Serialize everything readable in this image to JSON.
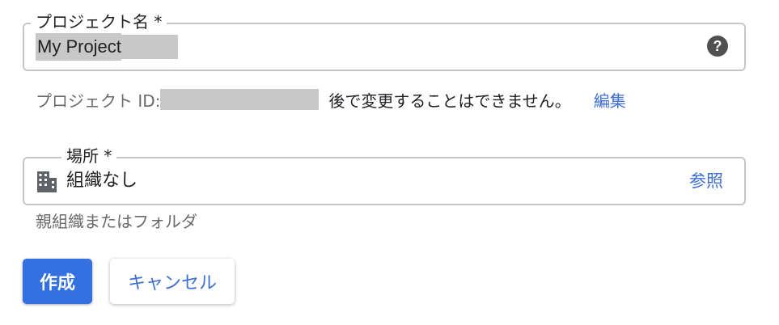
{
  "project_name": {
    "label": "プロジェクト名 *",
    "value": "My Project",
    "help_icon": "help-circle-icon"
  },
  "project_id": {
    "label": "プロジェクト ID:",
    "note": "後で変更することはできません。",
    "edit_label": "編集"
  },
  "location": {
    "label": "場所 *",
    "icon": "building-icon",
    "value": "組織なし",
    "browse_label": "参照",
    "helper": "親組織またはフォルダ"
  },
  "actions": {
    "create_label": "作成",
    "cancel_label": "キャンセル"
  },
  "colors": {
    "accent": "#3370e0",
    "link": "#3f6fd0",
    "border": "#c6c6c6"
  }
}
